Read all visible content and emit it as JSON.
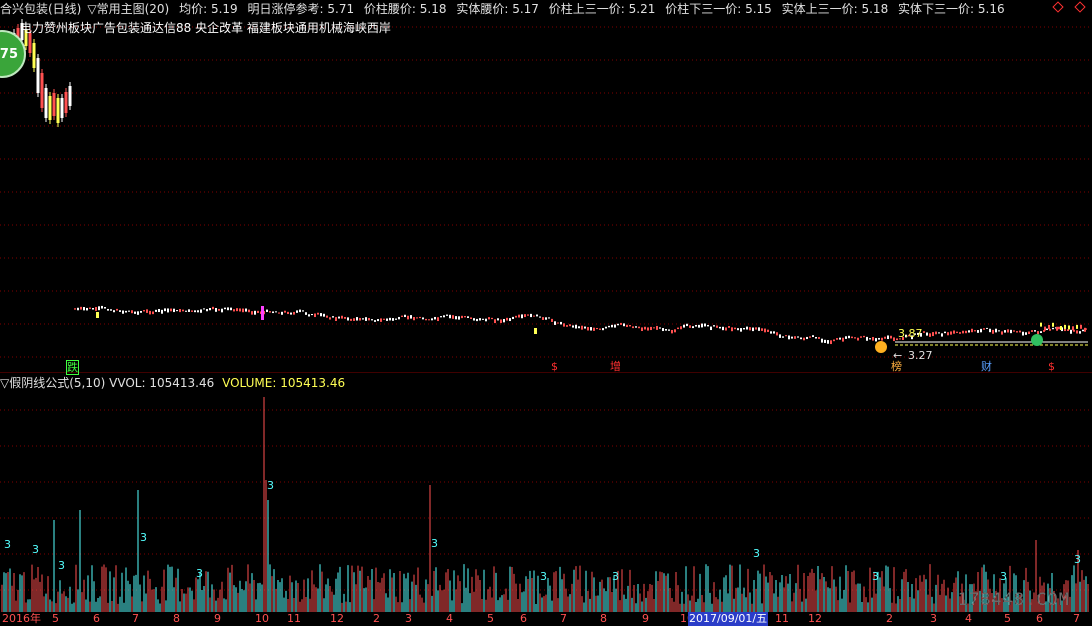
{
  "header": {
    "title": "合兴包装(日线)",
    "indicator_menu": "▽常用主图(20)",
    "items": [
      {
        "label": "均价:",
        "value": "5.19"
      },
      {
        "label": "明日涨停参考:",
        "value": "5.71"
      },
      {
        "label": "价柱腰价:",
        "value": "5.18"
      },
      {
        "label": "实体腰价:",
        "value": "5.17"
      },
      {
        "label": "价柱上三一价:",
        "value": "5.21"
      },
      {
        "label": "价柱下三一价:",
        "value": "5.15"
      },
      {
        "label": "实体上三一价:",
        "value": "5.18"
      },
      {
        "label": "实体下三一价:",
        "value": "5.16"
      }
    ]
  },
  "concepts": "电力赞州板块广告包装通达信88 央企改革 福建板块通用机械海峡西岸",
  "badge": "75",
  "price_labels": {
    "high": "3.87",
    "low": "3.27",
    "low_arrow": "←"
  },
  "events": [
    {
      "text": "跌",
      "color": "#40ff40"
    },
    {
      "text": "$",
      "color": "#ff3030"
    },
    {
      "text": "增",
      "color": "#ff3030"
    },
    {
      "text": "榜",
      "color": "#ffb040"
    },
    {
      "text": "财",
      "color": "#5aa0ff"
    },
    {
      "text": "$",
      "color": "#ff3030"
    }
  ],
  "sub_chart": {
    "menu": "▽假阴线公式(5,10)",
    "vvol_label": "VVOL:",
    "vvol_value": "105413.46",
    "volume_label": "VOLUME:",
    "volume_value": "105413.46"
  },
  "date_axis": {
    "labels": [
      "2016年",
      "5",
      "6",
      "7",
      "8",
      "9",
      "10",
      "11",
      "12",
      "2",
      "3",
      "4",
      "5",
      "6",
      "7",
      "8",
      "9",
      "10",
      "11",
      "12",
      "2",
      "3",
      "4",
      "5",
      "6",
      "7"
    ],
    "highlight": "2017/09/01/五"
  },
  "watermark": "178448.COM",
  "colors": {
    "grid": "#800000",
    "up": "#ff5050",
    "down": "#54ffff",
    "flat": "#ffffff",
    "yellow": "#ffff54",
    "magenta": "#ff40ff"
  }
}
